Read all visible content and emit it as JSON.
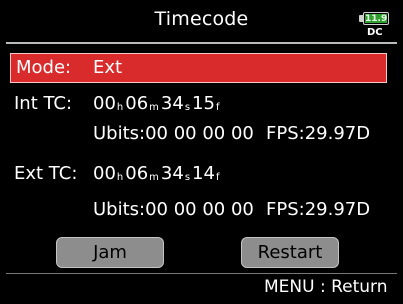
{
  "header": {
    "title": "Timecode",
    "battery_level": "11.9",
    "power_source": "DC"
  },
  "mode": {
    "label": "Mode:",
    "value": "Ext"
  },
  "int_tc": {
    "label": "Int TC:",
    "hours": "00",
    "h_sep": "h",
    "minutes": "06",
    "m_sep": "m",
    "seconds": "34",
    "s_sep": "s",
    "frames": "15",
    "f_sep": "f",
    "ubits": "Ubits:00 00 00 00",
    "fps": "FPS:29.97D"
  },
  "ext_tc": {
    "label": "Ext TC:",
    "hours": "00",
    "h_sep": "h",
    "minutes": "06",
    "m_sep": "m",
    "seconds": "34",
    "s_sep": "s",
    "frames": "14",
    "f_sep": "f",
    "ubits": "Ubits:00 00 00 00",
    "fps": "FPS:29.97D"
  },
  "buttons": {
    "jam": "Jam",
    "restart": "Restart"
  },
  "footer": {
    "hint": "MENU : Return"
  }
}
